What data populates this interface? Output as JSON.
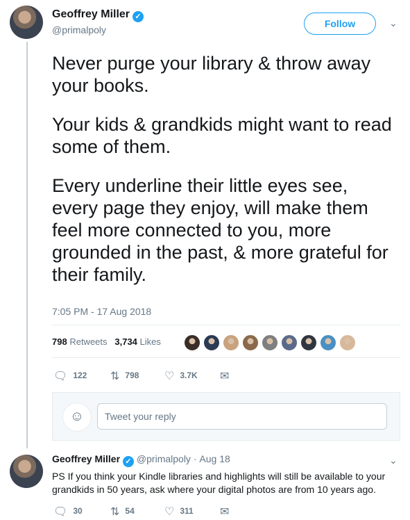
{
  "main_tweet": {
    "author_name": "Geoffrey Miller",
    "handle": "@primalpoly",
    "follow_label": "Follow",
    "paragraphs": [
      "Never purge your library & throw away your books.",
      "Your kids & grandkids might want to read some of them.",
      "Every underline their little eyes see, every page they enjoy, will make them feel more connected to you, more grounded in the past, & more grateful for their family."
    ],
    "timestamp": "7:05 PM - 17 Aug 2018",
    "retweets_count": "798",
    "retweets_label": "Retweets",
    "likes_count": "3,734",
    "likes_label": "Likes",
    "liker_colors": [
      "#3a2d28",
      "#2b3a55",
      "#c9a27e",
      "#8a6a4a",
      "#7f7f7f",
      "#5a6a8a",
      "#2f3640",
      "#4a90c2",
      "#d8b89a"
    ],
    "actions": {
      "replies": "122",
      "retweets": "798",
      "likes": "3.7K"
    },
    "reply_placeholder": "Tweet your reply"
  },
  "reply_tweet": {
    "author_name": "Geoffrey Miller",
    "handle": "@primalpoly",
    "separator": "·",
    "date": "Aug 18",
    "text": "PS If you think your Kindle libraries and highlights will still be available to your grandkids in 50 years, ask where your digital photos are from 10 years ago.",
    "actions": {
      "replies": "30",
      "retweets": "54",
      "likes": "311"
    }
  },
  "icons": {
    "verified": "verified-badge-icon",
    "chevron": "chevron-down-icon",
    "reply": "reply-icon",
    "retweet": "retweet-icon",
    "like": "heart-icon",
    "dm": "envelope-icon"
  },
  "colors": {
    "accent": "#1da1f2",
    "muted": "#657786",
    "text": "#14171a"
  }
}
